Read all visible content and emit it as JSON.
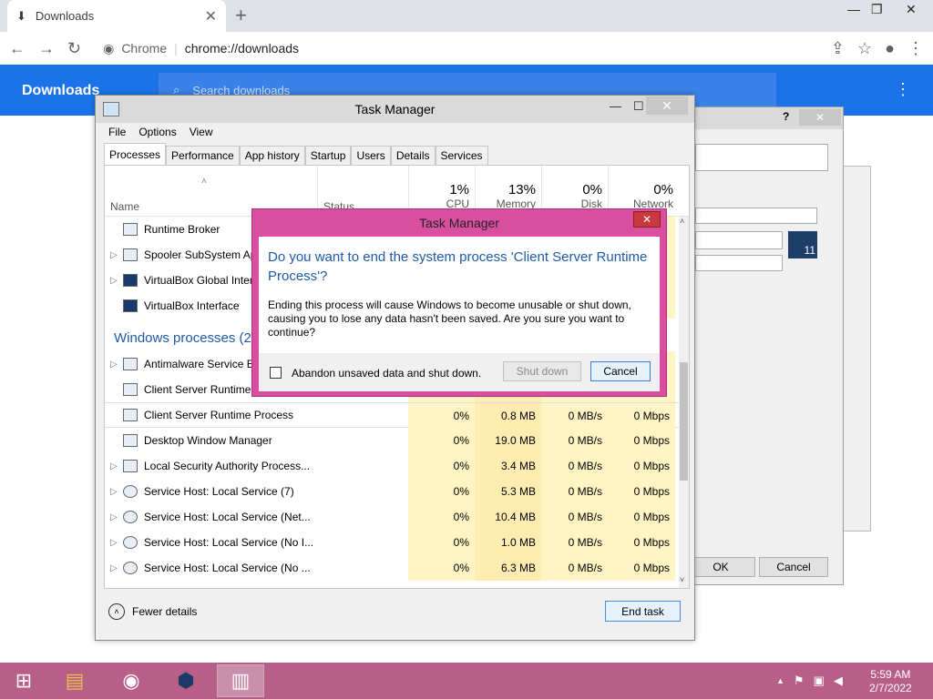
{
  "chrome": {
    "tab_title": "Downloads",
    "tab_close": "✕",
    "new_tab": "+",
    "omnibox_site": "Chrome",
    "omnibox_url": "chrome://downloads",
    "window_min": "—",
    "window_max": "❐",
    "window_close": "✕"
  },
  "downloads": {
    "title": "Downloads",
    "search_placeholder": "Search downloads"
  },
  "bg_dialog": {
    "help": "?",
    "close": "✕",
    "ok": "OK",
    "cancel": "Cancel",
    "badge": "11"
  },
  "task_manager": {
    "title": "Task Manager",
    "menu": [
      "File",
      "Options",
      "View"
    ],
    "tabs": [
      "Processes",
      "Performance",
      "App history",
      "Startup",
      "Users",
      "Details",
      "Services"
    ],
    "columns": {
      "name": "Name",
      "status": "Status",
      "cpu_pct": "1%",
      "cpu": "CPU",
      "mem_pct": "13%",
      "mem": "Memory",
      "disk_pct": "0%",
      "disk": "Disk",
      "net_pct": "0%",
      "net": "Network"
    },
    "rows_top": [
      {
        "name": "Runtime Broker",
        "expand": ""
      },
      {
        "name": "Spooler SubSystem App",
        "expand": "▷"
      },
      {
        "name": "VirtualBox Global Interface",
        "expand": "▷"
      },
      {
        "name": "VirtualBox Interface",
        "expand": ""
      }
    ],
    "group": "Windows processes (26)",
    "rows": [
      {
        "name": "Antimalware Service Executable",
        "expand": "▷",
        "cpu": "",
        "mem": "",
        "disk": "",
        "net": ""
      },
      {
        "name": "Client Server Runtime Process",
        "expand": "",
        "cpu": "",
        "mem": "",
        "disk": "",
        "net": ""
      },
      {
        "name": "Client Server Runtime Process",
        "expand": "",
        "cpu": "0%",
        "mem": "0.8 MB",
        "disk": "0 MB/s",
        "net": "0 Mbps"
      },
      {
        "name": "Desktop Window Manager",
        "expand": "",
        "cpu": "0%",
        "mem": "19.0 MB",
        "disk": "0 MB/s",
        "net": "0 Mbps"
      },
      {
        "name": "Local Security Authority Process...",
        "expand": "▷",
        "cpu": "0%",
        "mem": "3.4 MB",
        "disk": "0 MB/s",
        "net": "0 Mbps"
      },
      {
        "name": "Service Host: Local Service (7)",
        "expand": "▷",
        "cpu": "0%",
        "mem": "5.3 MB",
        "disk": "0 MB/s",
        "net": "0 Mbps"
      },
      {
        "name": "Service Host: Local Service (Net...",
        "expand": "▷",
        "cpu": "0%",
        "mem": "10.4 MB",
        "disk": "0 MB/s",
        "net": "0 Mbps"
      },
      {
        "name": "Service Host: Local Service (No I...",
        "expand": "▷",
        "cpu": "0%",
        "mem": "1.0 MB",
        "disk": "0 MB/s",
        "net": "0 Mbps"
      },
      {
        "name": "Service Host: Local Service (No ...",
        "expand": "▷",
        "cpu": "0%",
        "mem": "6.3 MB",
        "disk": "0 MB/s",
        "net": "0 Mbps"
      }
    ],
    "fewer_details": "Fewer details",
    "end_task": "End task"
  },
  "confirm": {
    "title": "Task Manager",
    "close": "✕",
    "question": "Do you want to end the system process 'Client Server Runtime Process'?",
    "message": "Ending this process will cause Windows to become unusable or shut down, causing you to lose any data hasn't been saved. Are you sure you want to continue?",
    "checkbox_label": "Abandon unsaved data and shut down.",
    "shutdown": "Shut down",
    "cancel": "Cancel"
  },
  "taskbar": {
    "time": "5:59 AM",
    "date": "2/7/2022",
    "tray_up": "▲"
  },
  "colors": {
    "chrome_blue": "#1a73e8",
    "taskbar": "#b85f87",
    "dialog_frame": "#d94fa0",
    "link_blue": "#1e5aa8"
  }
}
